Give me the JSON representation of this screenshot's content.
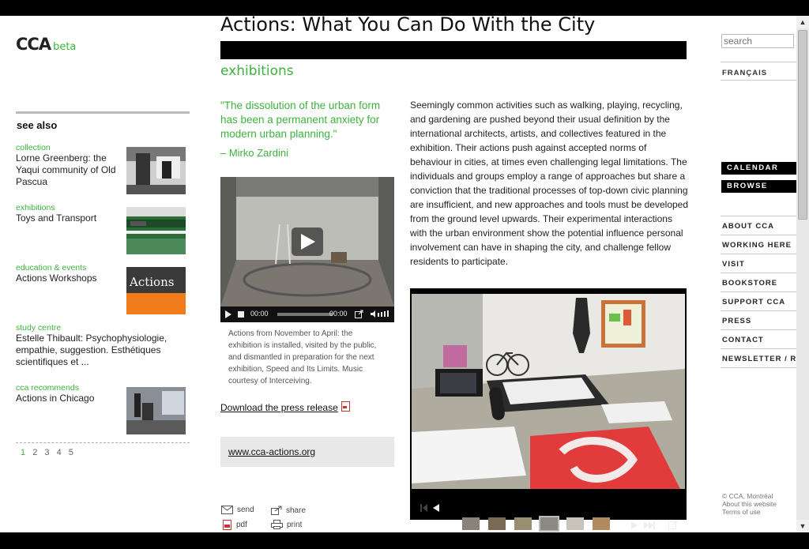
{
  "logo": {
    "name": "CCA",
    "beta": "beta"
  },
  "see_also": {
    "heading": "see also",
    "items": [
      {
        "category": "collection",
        "title": "Lorne Greenberg: the Yaqui community of Old Pascua"
      },
      {
        "category": "exhibitions",
        "title": "Toys and Transport"
      },
      {
        "category": "education & events",
        "title": "Actions Workshops",
        "thumb_label": "Actions"
      },
      {
        "category": "study centre",
        "title": "Estelle Thibault: Psychophysiologie, empathie, suggestion. Esthétiques scientifiques et ..."
      },
      {
        "category": "cca recommends",
        "title": "Actions in Chicago"
      }
    ],
    "pages": [
      "1",
      "2",
      "3",
      "4",
      "5"
    ]
  },
  "main": {
    "title": "Actions: What You Can Do With the City",
    "section": "exhibitions",
    "quote": " \"The dissolution of the urban form has been a permanent anxiety for modern urban planning.\"",
    "quote_author": "– Mirko Zardini",
    "video": {
      "time_current": "00:00",
      "time_total": "00:00"
    },
    "caption": "Actions from November to April: the exhibition is installed, visited by the public, and dismantled in preparation for the next exhibition, Speed and Its Limits. Music courtesy of Interceiving.",
    "press_link": "Download the press release",
    "website": "www.cca-actions.org",
    "share": {
      "send": "send",
      "share": "share",
      "pdf": "pdf",
      "print": "print"
    },
    "body": "Seemingly common activities such as walking, playing, recycling, and gardening are pushed beyond their usual definition by the international architects, artists, and collectives featured in the exhibition. Their actions push against accepted norms of behaviour in cities, at times even challenging legal limitations. The individuals and groups employ a range of approaches but share a conviction that the traditional processes of top-down civic planning are insufficient, and new approaches and tools must be developed from the ground level upwards. Their experimental interactions with the urban environment show the potential influence personal involvement can have in shaping the city, and challenge fellow residents to participate."
  },
  "right": {
    "search_placeholder": "search",
    "language": "FRANÇAIS",
    "calendar": "CALENDAR",
    "browse": "BROWSE",
    "nav": [
      "ABOUT CCA",
      "WORKING HERE",
      "VISIT",
      "BOOKSTORE",
      "SUPPORT CCA",
      "PRESS",
      "CONTACT",
      "NEWSLETTER / RSS"
    ],
    "footer": [
      "© CCA, Montréal",
      "About this website",
      "Terms of use"
    ]
  },
  "colors": {
    "accent": "#3cb33c",
    "text": "#222222"
  }
}
